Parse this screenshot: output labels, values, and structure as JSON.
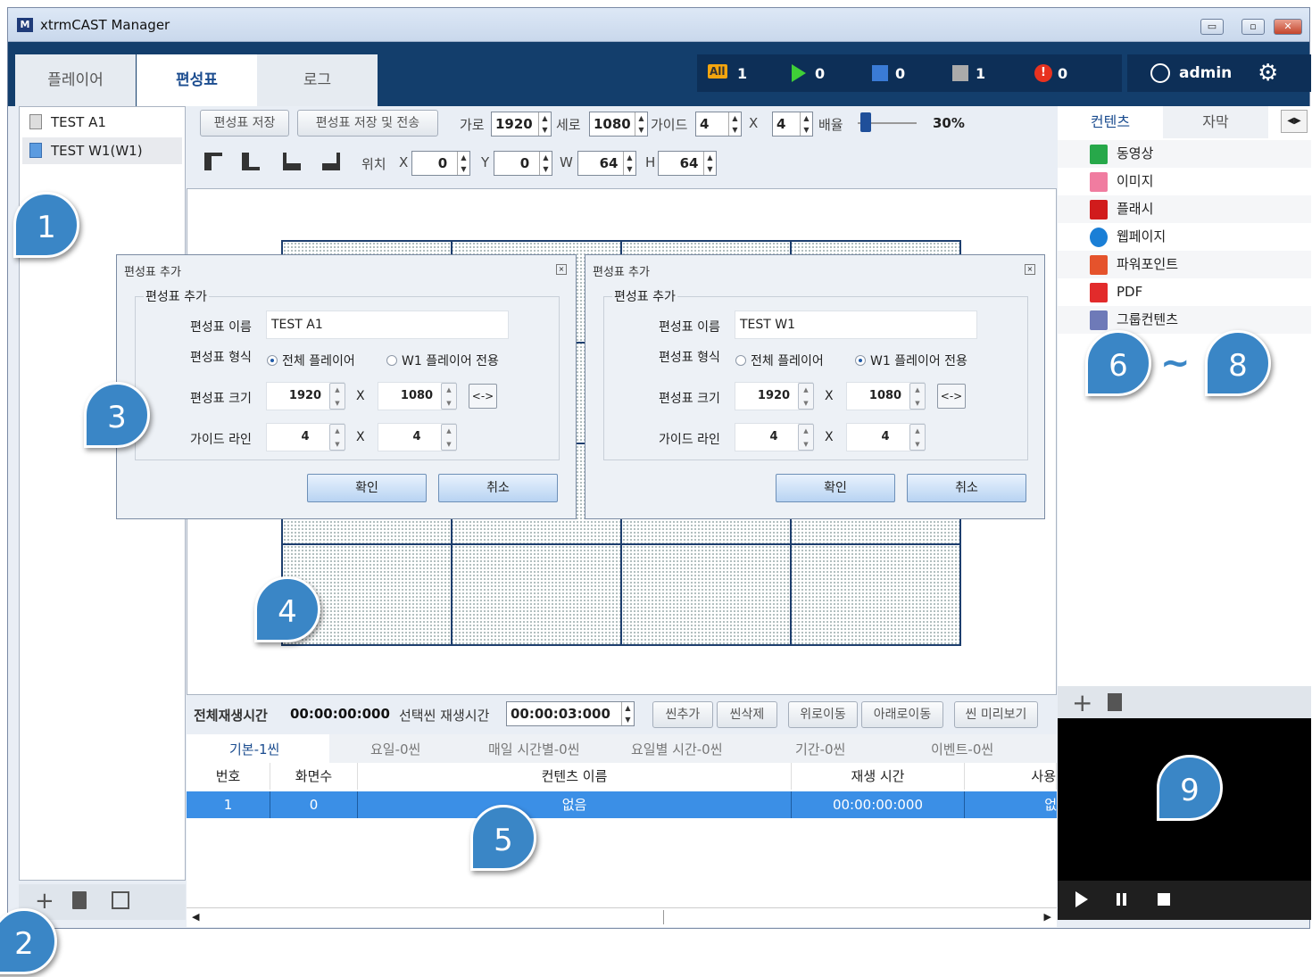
{
  "window": {
    "title": "xtrmCAST Manager",
    "logo": "M",
    "min": "▭",
    "max": "▫",
    "close": "✕"
  },
  "tabs": [
    "플레이어",
    "편성표",
    "로그"
  ],
  "status": {
    "all_label": "All",
    "all": "1",
    "play": "0",
    "blue": "0",
    "gray": "1",
    "error": "0"
  },
  "user": {
    "name": "admin"
  },
  "schedules": [
    {
      "label": "TEST A1"
    },
    {
      "label": "TEST W1(W1)"
    }
  ],
  "toolbar": {
    "save": "편성표 저장",
    "save_send": "편성표 저장 및 전송",
    "width_label": "가로",
    "width": "1920",
    "height_label": "세로",
    "height": "1080",
    "guide_label": "가이드",
    "guide_x": "4",
    "x": "X",
    "guide_y": "4",
    "scale_label": "배율",
    "scale": "30%"
  },
  "toolbar2": {
    "pos_label": "위치",
    "x_label": "X",
    "x": "0",
    "y_label": "Y",
    "y": "0",
    "w_label": "W",
    "w": "64",
    "h_label": "H",
    "h": "64"
  },
  "dialog1": {
    "title": "편성표 추가",
    "group": "편성표 추가",
    "name_label": "편성표 이름",
    "name": "TEST A1",
    "type_label": "편성표 형식",
    "opt1": "전체 플레이어",
    "opt2": "W1 플레이어 전용",
    "size_label": "편성표 크기",
    "w": "1920",
    "x": "X",
    "h": "1080",
    "swap": "<->",
    "guide_label": "가이드 라인",
    "gx": "4",
    "gy": "4",
    "ok": "확인",
    "cancel": "취소"
  },
  "dialog2": {
    "title": "편성표 추가",
    "group": "편성표 추가",
    "name_label": "편성표 이름",
    "name": "TEST W1",
    "type_label": "편성표 형식",
    "opt1": "전체 플레이어",
    "opt2": "W1 플레이어 전용",
    "size_label": "편성표 크기",
    "w": "1920",
    "x": "X",
    "h": "1080",
    "swap": "<->",
    "guide_label": "가이드 라인",
    "gx": "4",
    "gy": "4",
    "ok": "확인",
    "cancel": "취소"
  },
  "bottom": {
    "total_label": "전체재생시간",
    "total": "00:00:00:000",
    "sel_label": "선택씬 재생시간",
    "sel": "00:00:03:000",
    "add": "씬추가",
    "del": "씬삭제",
    "up": "위로이동",
    "down": "아래로이동",
    "preview": "씬 미리보기"
  },
  "scene_tabs": [
    "기본-1씬",
    "요일-0씬",
    "매일 시간별-0씬",
    "요일별 시간-0씬",
    "기간-0씬",
    "이벤트-0씬"
  ],
  "table": {
    "headers": [
      "번호",
      "화면수",
      "컨텐츠 이름",
      "재생 시간",
      "사용"
    ],
    "row": [
      "1",
      "0",
      "없음",
      "00:00:00:000",
      "없"
    ]
  },
  "right": {
    "tab1": "컨텐츠",
    "tab2": "자막",
    "items": [
      "동영상",
      "이미지",
      "플래시",
      "웹페이지",
      "파워포인트",
      "PDF",
      "그룹컨텐츠"
    ]
  },
  "badges": [
    "1",
    "2",
    "3",
    "4",
    "5",
    "6",
    "~",
    "8",
    "9"
  ]
}
